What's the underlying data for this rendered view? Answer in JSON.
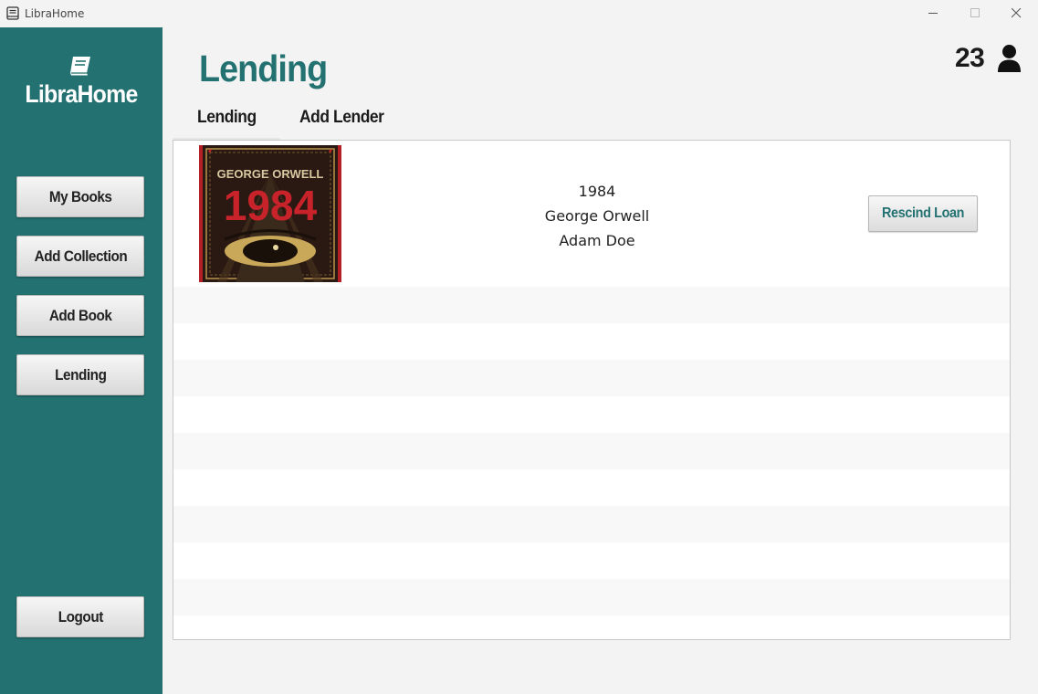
{
  "window": {
    "title": "LibraHome"
  },
  "sidebar": {
    "brand": "LibraHome",
    "items": [
      {
        "label": "My Books"
      },
      {
        "label": "Add Collection"
      },
      {
        "label": "Add Book"
      },
      {
        "label": "Lending"
      }
    ],
    "logout_label": "Logout"
  },
  "header": {
    "title": "Lending",
    "count": "23"
  },
  "tabs": [
    {
      "label": "Lending",
      "selected": true
    },
    {
      "label": "Add Lender",
      "selected": false
    }
  ],
  "loans": [
    {
      "title": "1984",
      "author": "George Orwell",
      "lender": "Adam Doe",
      "cover_text_top": "GEORGE ORWELL",
      "cover_text_big": "1984",
      "action_label": "Rescind Loan"
    }
  ],
  "colors": {
    "accent": "#237271",
    "background": "#f3f3f3"
  },
  "icons": {
    "app": "book-icon",
    "logo": "book-icon",
    "user": "user-icon"
  }
}
